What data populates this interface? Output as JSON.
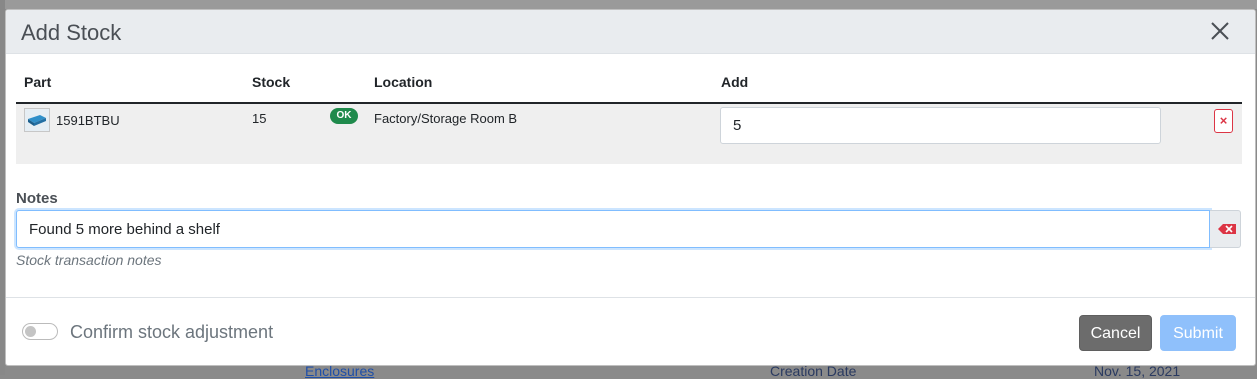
{
  "background": {
    "link_text": "Enclosures",
    "creation_date_label": "Creation Date",
    "creation_date_value": "Nov. 15, 2021"
  },
  "modal": {
    "title": "Add Stock",
    "table": {
      "headers": {
        "part": "Part",
        "stock": "Stock",
        "location": "Location",
        "add": "Add"
      },
      "rows": [
        {
          "part": "1591BTBU",
          "stock": "15",
          "status_badge": "OK",
          "location": "Factory/Storage Room B",
          "add_value": "5",
          "remove_label": "×"
        }
      ]
    },
    "notes": {
      "label": "Notes",
      "value": "Found 5 more behind a shelf",
      "help_text": "Stock transaction notes"
    },
    "confirm_toggle": {
      "label": "Confirm stock adjustment",
      "checked": false
    },
    "buttons": {
      "cancel": "Cancel",
      "submit": "Submit"
    }
  },
  "colors": {
    "ok_badge": "#1f8a4c",
    "remove": "#dc3545",
    "cancel": "#6c6c6c",
    "submit": "#8fc0fb"
  },
  "icons": [
    "close-icon",
    "part-thumbnail",
    "remove-icon",
    "clear-icon"
  ]
}
